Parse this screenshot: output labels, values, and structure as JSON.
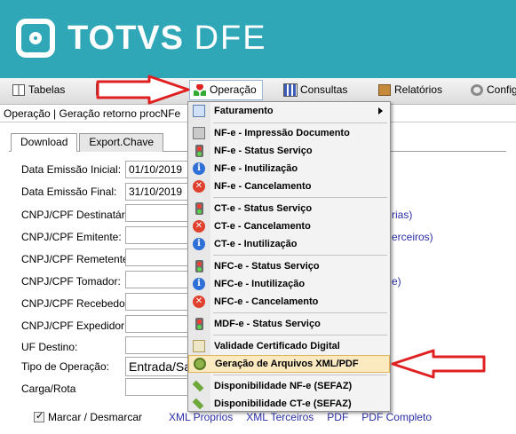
{
  "brand": {
    "bold": "TOTVS",
    "light": "DFE"
  },
  "menubar": {
    "items": [
      {
        "label": "Tabelas"
      },
      {
        "label": "Operação"
      },
      {
        "label": "Consultas"
      },
      {
        "label": "Relatórios"
      },
      {
        "label": "Configu"
      }
    ]
  },
  "breadcrumb": "Operação | Geração retorno procNFe",
  "tabs": [
    "Download",
    "Export.Chave"
  ],
  "form": {
    "data_emissao_inicial_label": "Data Emissão Inicial:",
    "data_emissao_inicial_value": "01/10/2019",
    "data_emissao_final_label": "Data Emissão Final:",
    "data_emissao_final_value": "31/10/2019",
    "cnpj_destinatario_label": "CNPJ/CPF Destinatário:",
    "cnpj_emitente_label": "CNPJ/CPF Emitente:",
    "cnpj_remetente_label": "CNPJ/CPF Remetente:",
    "cnpj_tomador_label": "CNPJ/CPF Tomador:",
    "cnpj_recebedor_label": "CNPJ/CPF Recebedor:",
    "cnpj_expedidor_label": "CNPJ/CPF Expedidor:",
    "uf_destino_label": "UF Destino:",
    "tipo_operacao_label": "Tipo de Operação:",
    "tipo_operacao_value": "Entrada/Sa",
    "carga_rota_label": "Carga/Rota",
    "side_1": "rias)",
    "side_2": "erceiros)",
    "side_3": "e)"
  },
  "bottom": {
    "marcar": "Marcar / Desmarcar",
    "links": [
      "XML Proprios",
      "XML Terceiros",
      "PDF",
      "PDF Completo"
    ]
  },
  "menu": {
    "items": [
      {
        "label": "Faturamento",
        "icon": "presentation-icon"
      },
      {
        "label": "NF-e - Impressão Documento",
        "icon": "printer-icon"
      },
      {
        "label": "NF-e - Status Serviço",
        "icon": "traffic-light-icon"
      },
      {
        "label": "NF-e - Inutilização",
        "icon": "info-icon"
      },
      {
        "label": "NF-e - Cancelamento",
        "icon": "cancel-icon"
      },
      {
        "label": "CT-e - Status Serviço",
        "icon": "traffic-light-icon"
      },
      {
        "label": "CT-e - Cancelamento",
        "icon": "cancel-icon"
      },
      {
        "label": "CT-e - Inutilização",
        "icon": "info-icon"
      },
      {
        "label": "NFC-e - Status Serviço",
        "icon": "traffic-light-icon"
      },
      {
        "label": "NFC-e - Inutilização",
        "icon": "info-icon"
      },
      {
        "label": "NFC-e - Cancelamento",
        "icon": "cancel-icon"
      },
      {
        "label": "MDF-e - Status Serviço",
        "icon": "traffic-light-icon"
      },
      {
        "label": "Validade Certificado Digital",
        "icon": "certificate-icon"
      },
      {
        "label": "Geração de Arquivos XML/PDF",
        "icon": "gear-icon"
      },
      {
        "label": "Disponibilidade NF-e (SEFAZ)",
        "icon": "plug-icon"
      },
      {
        "label": "Disponibilidade CT-e (SEFAZ)",
        "icon": "plug-icon"
      }
    ]
  },
  "colors": {
    "banner": "#2fa7b7",
    "highlight": "#fbe9bf",
    "annotation_arrow": "#e02020",
    "link": "#2b2fa8"
  }
}
